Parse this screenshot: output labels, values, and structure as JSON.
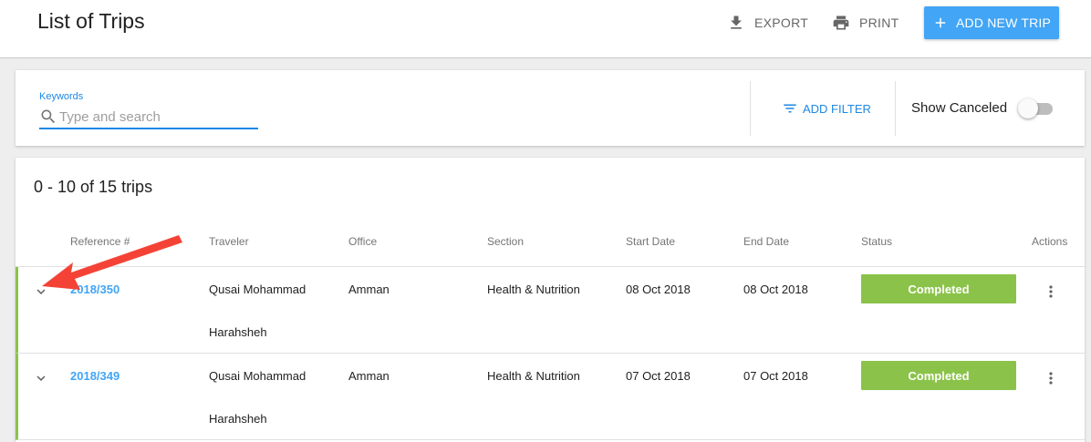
{
  "header": {
    "title": "List of Trips",
    "export_label": "EXPORT",
    "print_label": "PRINT",
    "add_label": "ADD NEW TRIP",
    "accent": "#42a5f5"
  },
  "filters": {
    "keywords_label": "Keywords",
    "search_placeholder": "Type and search",
    "search_value": "",
    "add_filter_label": "ADD FILTER",
    "show_canceled_label": "Show Canceled",
    "show_canceled_on": false
  },
  "table": {
    "count_text": "0 - 10 of 15 trips",
    "columns": [
      "Reference #",
      "Traveler",
      "Office",
      "Section",
      "Start Date",
      "End Date",
      "Status",
      "Actions"
    ],
    "rows": [
      {
        "reference": "2018/350",
        "traveler": "Qusai Mohammad Harahsheh",
        "office": "Amman",
        "section": "Health & Nutrition",
        "start_date": "08 Oct 2018",
        "end_date": "08 Oct 2018",
        "status": "Completed"
      },
      {
        "reference": "2018/349",
        "traveler": "Qusai Mohammad Harahsheh",
        "office": "Amman",
        "section": "Health & Nutrition",
        "start_date": "07 Oct 2018",
        "end_date": "07 Oct 2018",
        "status": "Completed"
      }
    ],
    "status_color": "#8bc34a"
  },
  "icons": {
    "export": "download-icon",
    "print": "printer-icon",
    "add": "plus-icon",
    "search": "search-icon",
    "filter": "filter-icon",
    "expand": "chevron-down-icon",
    "actions": "more-vert-icon"
  },
  "annotation": {
    "color": "#f44336"
  }
}
